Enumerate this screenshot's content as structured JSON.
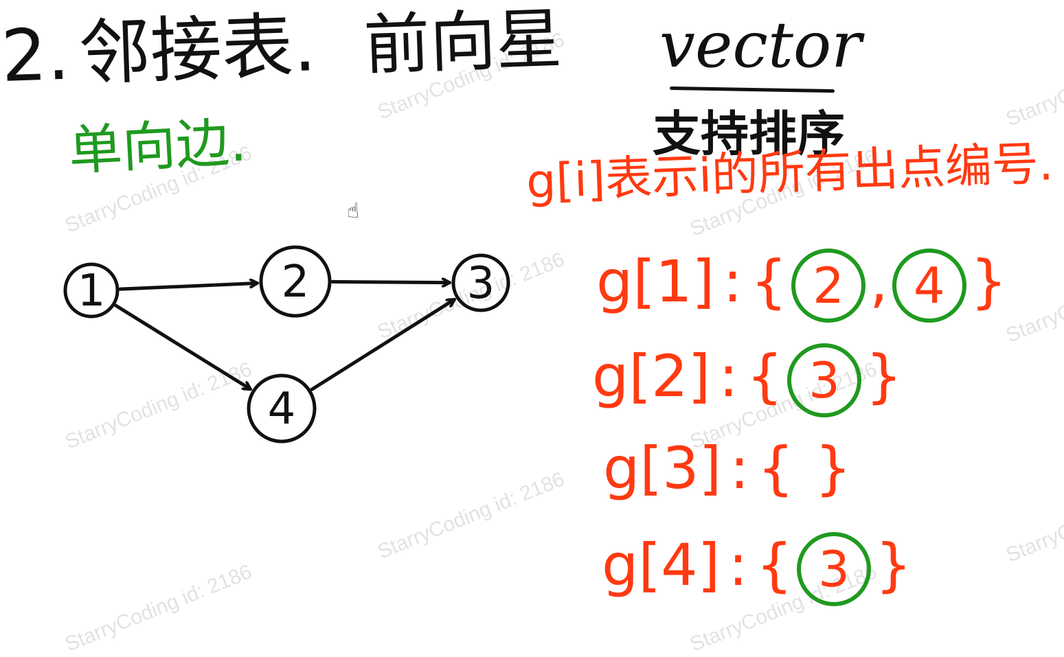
{
  "heading": {
    "prefix": "2.",
    "title": "邻接表",
    "sep": ".",
    "method_forward_star": "前向星",
    "method_vector": "vector"
  },
  "notes": {
    "sort": "支持排序",
    "directed": "单向边.",
    "definition": "g[i]表示i的所有出点编号."
  },
  "graph": {
    "nodes": [
      {
        "id": "1"
      },
      {
        "id": "2"
      },
      {
        "id": "3"
      },
      {
        "id": "4"
      }
    ],
    "edges": [
      {
        "from": "1",
        "to": "2"
      },
      {
        "from": "2",
        "to": "3"
      },
      {
        "from": "1",
        "to": "4"
      },
      {
        "from": "4",
        "to": "3"
      }
    ]
  },
  "adjacency": [
    {
      "key": "g[1]",
      "sep": ":",
      "open": "{",
      "values": [
        "2",
        "4"
      ],
      "close": "}"
    },
    {
      "key": "g[2]",
      "sep": ":",
      "open": "{",
      "values": [
        "3"
      ],
      "close": "}"
    },
    {
      "key": "g[3]",
      "sep": ":",
      "open": "{",
      "values": [],
      "close": "}"
    },
    {
      "key": "g[4]",
      "sep": ":",
      "open": "{",
      "values": [
        "3"
      ],
      "close": "}"
    }
  ],
  "watermark": "StarryCoding id: 2186",
  "colors": {
    "ink": "#111111",
    "red": "#ff3a12",
    "green": "#1f9a1f",
    "watermark": "#969696"
  },
  "icons": {
    "cursor": "hand-cursor-icon"
  }
}
